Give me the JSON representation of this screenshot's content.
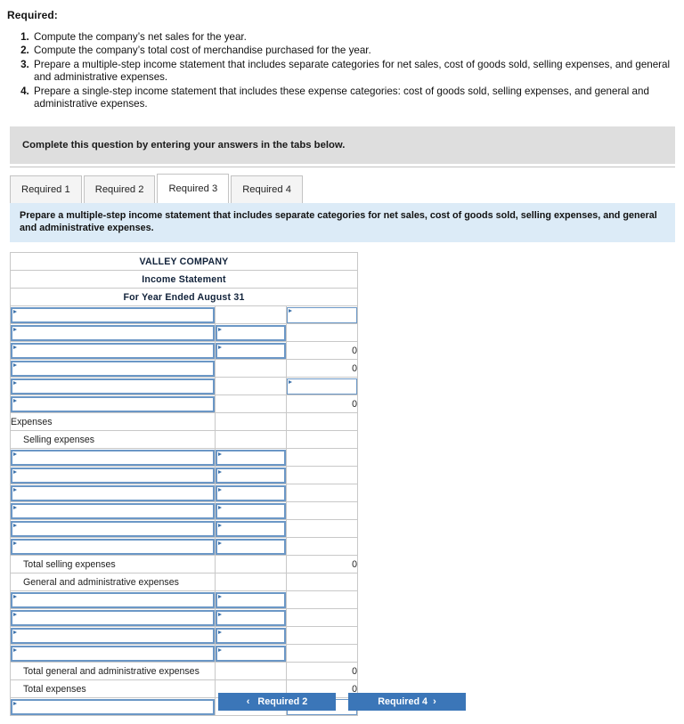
{
  "required": {
    "heading": "Required:",
    "items": [
      "Compute the company’s net sales for the year.",
      "Compute the company’s total cost of merchandise purchased for the year.",
      "Prepare a multiple-step income statement that includes separate categories for net sales, cost of goods sold, selling expenses, and general and administrative expenses.",
      "Prepare a single-step income statement that includes these expense categories: cost of goods sold, selling expenses, and general and administrative expenses."
    ]
  },
  "grey_banner": {
    "text": "Complete this question by entering your answers in the tabs below."
  },
  "tabs": [
    {
      "label": "Required 1",
      "active": false
    },
    {
      "label": "Required 2",
      "active": false
    },
    {
      "label": "Required 3",
      "active": true
    },
    {
      "label": "Required 4",
      "active": false
    }
  ],
  "info_banner": {
    "text": "Prepare a multiple-step income statement that includes separate categories for net sales, cost of goods sold, selling expenses, and general and administrative expenses."
  },
  "worksheet": {
    "header": {
      "company": "VALLEY COMPANY",
      "statement": "Income Statement",
      "period": "For Year Ended August 31"
    },
    "rows": [
      {
        "type": "input",
        "label": "",
        "mid": "",
        "right": "",
        "label_field": true,
        "mid_field": false,
        "right_field": true
      },
      {
        "type": "input",
        "label": "",
        "mid": "",
        "right": "",
        "label_field": true,
        "mid_field": true,
        "right_field": false
      },
      {
        "type": "input",
        "label": "",
        "mid": "",
        "right": "0",
        "label_field": true,
        "mid_field": true,
        "right_field": false
      },
      {
        "type": "input",
        "label": "",
        "mid": "",
        "right": "0",
        "label_field": true,
        "mid_field": false,
        "right_field": false,
        "mid_topline": true,
        "right_topline": true
      },
      {
        "type": "input",
        "label": "",
        "mid": "",
        "right": "",
        "label_field": true,
        "mid_field": false,
        "right_field": true
      },
      {
        "type": "input",
        "label": "",
        "mid": "",
        "right": "0",
        "label_field": true,
        "mid_field": false,
        "right_field": false,
        "right_topline": true
      },
      {
        "type": "text",
        "label": "Expenses",
        "indent": 0,
        "mid": "",
        "right": ""
      },
      {
        "type": "text",
        "label": "Selling expenses",
        "indent": 1,
        "mid": "",
        "right": ""
      },
      {
        "type": "input",
        "label": "",
        "mid": "",
        "right": "",
        "label_field": true,
        "mid_field": true,
        "right_field": false
      },
      {
        "type": "input",
        "label": "",
        "mid": "",
        "right": "",
        "label_field": true,
        "mid_field": true,
        "right_field": false
      },
      {
        "type": "input",
        "label": "",
        "mid": "",
        "right": "",
        "label_field": true,
        "mid_field": true,
        "right_field": false
      },
      {
        "type": "input",
        "label": "",
        "mid": "",
        "right": "",
        "label_field": true,
        "mid_field": true,
        "right_field": false
      },
      {
        "type": "input",
        "label": "",
        "mid": "",
        "right": "",
        "label_field": true,
        "mid_field": true,
        "right_field": false
      },
      {
        "type": "input",
        "label": "",
        "mid": "",
        "right": "",
        "label_field": true,
        "mid_field": true,
        "right_field": false
      },
      {
        "type": "text",
        "label": "Total selling expenses",
        "indent": 1,
        "mid": "",
        "right": "0",
        "mid_topline": true,
        "right_topline": true
      },
      {
        "type": "text",
        "label": "General and administrative expenses",
        "indent": 1,
        "mid": "",
        "right": ""
      },
      {
        "type": "input",
        "label": "",
        "mid": "",
        "right": "",
        "label_field": true,
        "mid_field": true,
        "right_field": false
      },
      {
        "type": "input",
        "label": "",
        "mid": "",
        "right": "",
        "label_field": true,
        "mid_field": true,
        "right_field": false
      },
      {
        "type": "input",
        "label": "",
        "mid": "",
        "right": "",
        "label_field": true,
        "mid_field": true,
        "right_field": false
      },
      {
        "type": "input",
        "label": "",
        "mid": "",
        "right": "",
        "label_field": true,
        "mid_field": true,
        "right_field": false
      },
      {
        "type": "text",
        "label": "Total general and administrative expenses",
        "indent": 1,
        "mid": "",
        "right": "0",
        "mid_topline": true
      },
      {
        "type": "text",
        "label": "Total expenses",
        "indent": 1,
        "mid": "",
        "right": "0",
        "right_topline": true
      },
      {
        "type": "input",
        "label": "",
        "mid": "",
        "right": "",
        "label_field": true,
        "mid_field": false,
        "right_field": true,
        "right_topline": true,
        "right_botline": true
      }
    ]
  },
  "nav": {
    "prev_label": "Required 2",
    "next_label": "Required 4",
    "prev_icon": "chevron-left-icon",
    "next_icon": "chevron-right-icon",
    "prev_glyph": "‹",
    "next_glyph": "›"
  },
  "colors": {
    "header_blue": "#6ea8e0",
    "banner_blue": "#dcebf7",
    "banner_grey": "#dedede",
    "button_blue": "#3b76b8",
    "field_border": "#6b97c6"
  }
}
